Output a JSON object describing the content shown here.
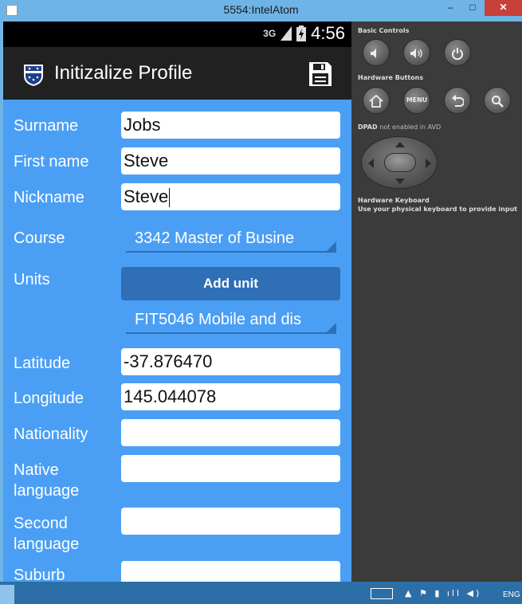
{
  "window": {
    "title": "5554:IntelAtom",
    "min_glyph": "–",
    "max_glyph": "□",
    "close_glyph": "✕"
  },
  "status_bar": {
    "network": "3G",
    "time": "4:56"
  },
  "action_bar": {
    "title": "Initizalize Profile",
    "logo_icon": "university-crest-icon",
    "save_icon": "save-icon"
  },
  "form": {
    "surname": {
      "label": "Surname",
      "value": "Jobs"
    },
    "first_name": {
      "label": "First name",
      "value": "Steve"
    },
    "nickname": {
      "label": "Nickname",
      "value": "Steve"
    },
    "course": {
      "label": "Course",
      "value": "3342 Master of Busine"
    },
    "units": {
      "label": "Units",
      "add_button": "Add unit",
      "value": "FIT5046 Mobile and dis"
    },
    "latitude": {
      "label": "Latitude",
      "value": "-37.876470"
    },
    "longitude": {
      "label": "Longitude",
      "value": "145.044078"
    },
    "nationality": {
      "label": "Nationality",
      "value": ""
    },
    "native_language": {
      "label_line1": "Native",
      "label_line2": "language",
      "value": ""
    },
    "second_language": {
      "label_line1": "Second",
      "label_line2": "language",
      "value": ""
    },
    "suburb": {
      "label": "Suburb",
      "value": ""
    }
  },
  "emulator_panel": {
    "basic_controls": "Basic Controls",
    "hardware_buttons": "Hardware Buttons",
    "menu_label": "MENU",
    "dpad_title": "DPAD",
    "dpad_note": "not enabled in AVD",
    "hardware_keyboard": "Hardware Keyboard",
    "keyboard_note": "Use your physical keyboard to provide input"
  },
  "taskbar": {
    "language": "ENG"
  },
  "colors": {
    "form_background": "#4a9ff5",
    "action_bar": "#212121",
    "add_button": "#2f6fb5",
    "panel": "#3b3b3b",
    "window_frame": "#6fb4e6",
    "close_button": "#c7403a"
  }
}
